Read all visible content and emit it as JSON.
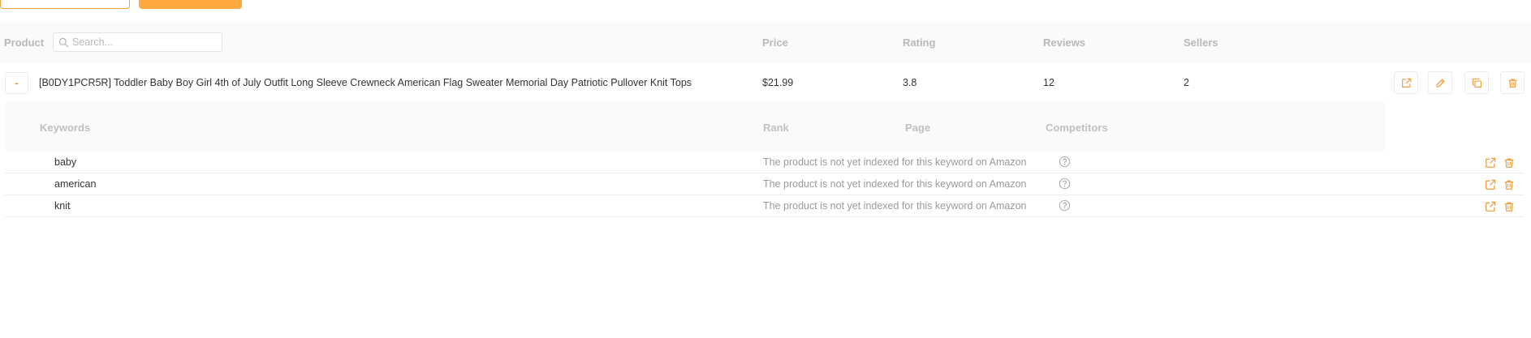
{
  "search": {
    "placeholder": "Search..."
  },
  "columns": {
    "product": "Product",
    "price": "Price",
    "rating": "Rating",
    "reviews": "Reviews",
    "sellers": "Sellers"
  },
  "product": {
    "collapse_symbol": "-",
    "title": "[B0DY1PCR5R] Toddler Baby Boy Girl 4th of July Outfit Long Sleeve Crewneck American Flag Sweater Memorial Day Patriotic Pullover Knit Tops",
    "price": "$21.99",
    "rating": "3.8",
    "reviews": "12",
    "sellers": "2"
  },
  "keyword_columns": {
    "keywords": "Keywords",
    "rank": "Rank",
    "page": "Page",
    "competitors": "Competitors"
  },
  "keywords": [
    {
      "keyword": "baby",
      "status": "The product is not yet indexed for this keyword on Amazon"
    },
    {
      "keyword": "american",
      "status": "The product is not yet indexed for this keyword on Amazon"
    },
    {
      "keyword": "knit",
      "status": "The product is not yet indexed for this keyword on Amazon"
    }
  ],
  "colors": {
    "accent": "#f0a040",
    "accent_fill": "#ffa940",
    "header_bg": "#fafafa",
    "header_text": "#b8b8b8",
    "muted_text": "#9a9a9a"
  },
  "icons": {
    "search": "search-icon",
    "open": "external-link-icon",
    "edit": "pencil-icon",
    "copy": "copy-icon",
    "delete": "trash-icon",
    "help": "help-circle-icon"
  }
}
